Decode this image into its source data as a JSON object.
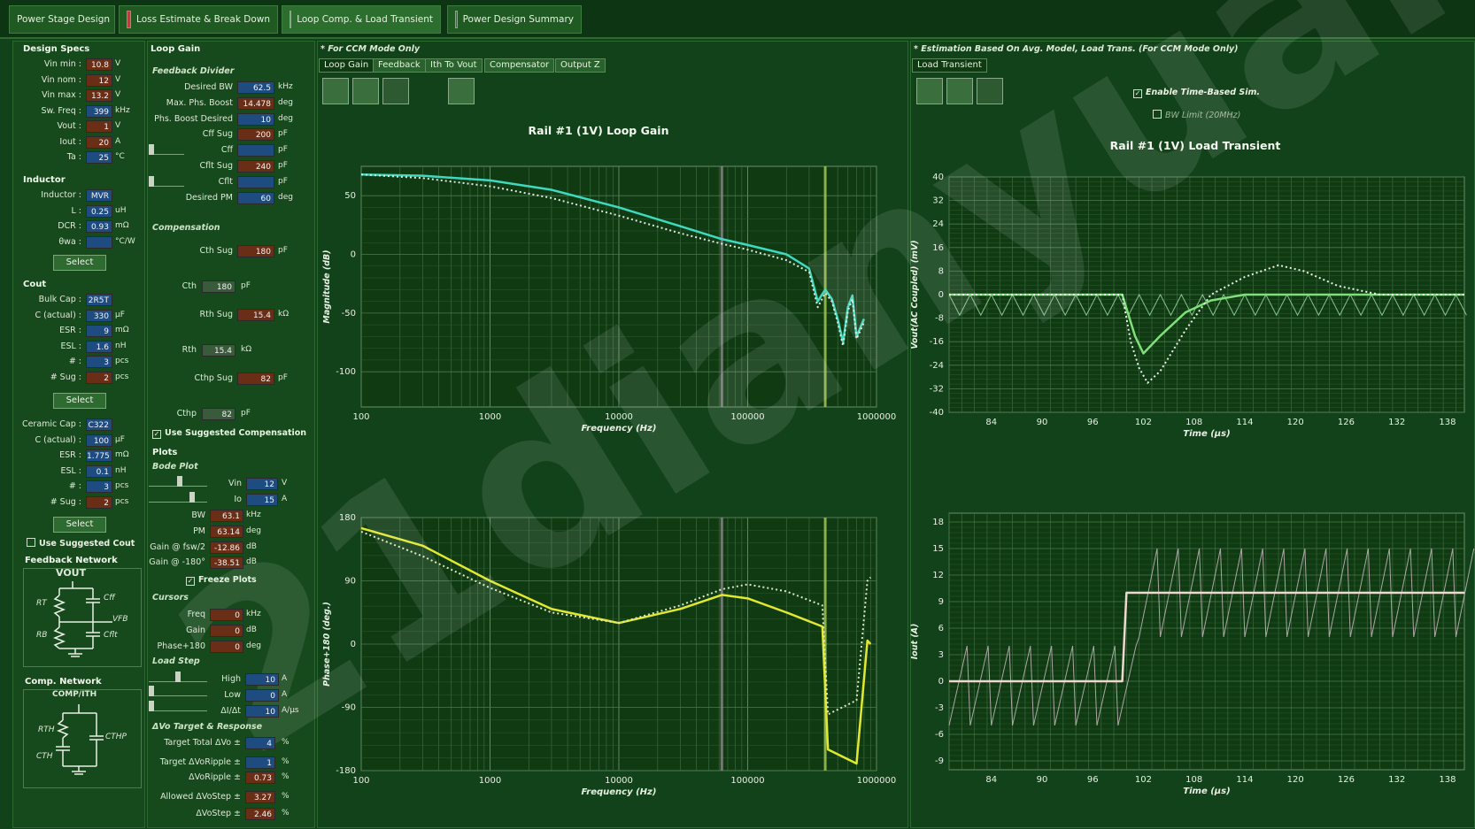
{
  "tabs": [
    {
      "label": "Power Stage Design"
    },
    {
      "label": "Loss Estimate & Break Down"
    },
    {
      "label": "Loop Comp. & Load Transient"
    },
    {
      "label": "Power Design Summary"
    }
  ],
  "design_specs": {
    "title": "Design Specs",
    "rows": [
      {
        "label": "Vin min :",
        "value": "10.8",
        "unit": "V",
        "color": "o"
      },
      {
        "label": "Vin nom :",
        "value": "12",
        "unit": "V",
        "color": "o"
      },
      {
        "label": "Vin max :",
        "value": "13.2",
        "unit": "V",
        "color": "o"
      },
      {
        "label": "Sw. Freq :",
        "value": "399",
        "unit": "kHz",
        "color": "b"
      },
      {
        "label": "Vout :",
        "value": "1",
        "unit": "V",
        "color": "o"
      },
      {
        "label": "Iout :",
        "value": "20",
        "unit": "A",
        "color": "o"
      },
      {
        "label": "Ta :",
        "value": "25",
        "unit": "°C",
        "color": "b"
      }
    ]
  },
  "inductor": {
    "title": "Inductor",
    "rows": [
      {
        "label": "Inductor :",
        "value": "MVR",
        "unit": "",
        "color": "b"
      },
      {
        "label": "L :",
        "value": "0.25",
        "unit": "uH",
        "color": "b"
      },
      {
        "label": "DCR :",
        "value": "0.93",
        "unit": "mΩ",
        "color": "b"
      },
      {
        "label": "θwa :",
        "value": "",
        "unit": "°C/W",
        "color": "b"
      }
    ],
    "select": "Select"
  },
  "cout": {
    "title": "Cout",
    "bulk": [
      {
        "label": "Bulk Cap :",
        "value": "2R5T",
        "unit": "",
        "color": "b"
      },
      {
        "label": "C (actual) :",
        "value": "330",
        "unit": "µF",
        "color": "b"
      },
      {
        "label": "ESR :",
        "value": "9",
        "unit": "mΩ",
        "color": "b"
      },
      {
        "label": "ESL :",
        "value": "1.6",
        "unit": "nH",
        "color": "b"
      },
      {
        "label": "# :",
        "value": "3",
        "unit": "pcs",
        "color": "b"
      },
      {
        "label": "# Sug :",
        "value": "2",
        "unit": "pcs",
        "color": "o"
      }
    ],
    "select1": "Select",
    "ceramic": [
      {
        "label": "Ceramic Cap :",
        "value": "C322",
        "unit": "",
        "color": "b"
      },
      {
        "label": "C (actual) :",
        "value": "100",
        "unit": "µF",
        "color": "b"
      },
      {
        "label": "ESR :",
        "value": "1.775",
        "unit": "mΩ",
        "color": "b"
      },
      {
        "label": "ESL :",
        "value": "0.1",
        "unit": "nH",
        "color": "b"
      },
      {
        "label": "# :",
        "value": "3",
        "unit": "pcs",
        "color": "b"
      },
      {
        "label": "# Sug :",
        "value": "2",
        "unit": "pcs",
        "color": "o"
      }
    ],
    "select2": "Select",
    "use_suggested": "Use Suggested Cout"
  },
  "feedback_network": {
    "title": "Feedback Network",
    "vout": "VOUT",
    "rt": "RT",
    "rb": "RB",
    "cff": "Cff",
    "cflt": "Cflt",
    "vfb": "VFB"
  },
  "comp_network": {
    "title": "Comp. Network",
    "node": "COMP/ITH",
    "rth": "RTH",
    "cth": "CTH",
    "cthp": "CTHP"
  },
  "loop_gain": {
    "title": "Loop Gain",
    "fb_title": "Feedback Divider",
    "fb_rows": [
      {
        "label": "Desired BW",
        "value": "62.5",
        "unit": "kHz",
        "color": "b"
      },
      {
        "label": "Max. Phs. Boost",
        "value": "14.478",
        "unit": "deg",
        "color": "o"
      },
      {
        "label": "Phs. Boost Desired",
        "value": "10",
        "unit": "deg",
        "color": "b"
      },
      {
        "label": "Cff Sug",
        "value": "200",
        "unit": "pF",
        "color": "o"
      },
      {
        "label": "Cff",
        "value": "",
        "unit": "pF",
        "color": "b"
      },
      {
        "label": "Cflt Sug",
        "value": "240",
        "unit": "pF",
        "color": "o"
      },
      {
        "label": "Cflt",
        "value": "",
        "unit": "pF",
        "color": "b"
      },
      {
        "label": "Desired PM",
        "value": "60",
        "unit": "deg",
        "color": "b"
      }
    ],
    "comp_title": "Compensation",
    "comp_rows": [
      {
        "label": "Cth Sug",
        "value": "180",
        "unit": "pF",
        "color": "o"
      },
      {
        "label": "Cth",
        "value": "180",
        "unit": "pF",
        "color": "g"
      },
      {
        "label": "Rth Sug",
        "value": "15.4",
        "unit": "kΩ",
        "color": "o"
      },
      {
        "label": "Rth",
        "value": "15.4",
        "unit": "kΩ",
        "color": "g"
      },
      {
        "label": "Cthp Sug",
        "value": "82",
        "unit": "pF",
        "color": "o"
      },
      {
        "label": "Cthp",
        "value": "82",
        "unit": "pF",
        "color": "g"
      }
    ],
    "use_suggested": "Use Suggested Compensation",
    "plots_title": "Plots",
    "bode_title": "Bode Plot",
    "bode_rows": [
      {
        "label": "Vin",
        "value": "12",
        "unit": "V",
        "color": "b"
      },
      {
        "label": "Io",
        "value": "15",
        "unit": "A",
        "color": "b"
      },
      {
        "label": "BW",
        "value": "63.1",
        "unit": "kHz",
        "color": "o"
      },
      {
        "label": "PM",
        "value": "63.14",
        "unit": "deg",
        "color": "o"
      },
      {
        "label": "Gain @ fsw/2",
        "value": "-12.86",
        "unit": "dB",
        "color": "o"
      },
      {
        "label": "Gain @ -180°",
        "value": "-38.51",
        "unit": "dB",
        "color": "o"
      }
    ],
    "freeze": "Freeze Plots",
    "cursors_title": "Cursors",
    "cursor_rows": [
      {
        "label": "Freq",
        "value": "0",
        "unit": "kHz",
        "color": "o"
      },
      {
        "label": "Gain",
        "value": "0",
        "unit": "dB",
        "color": "o"
      },
      {
        "label": "Phase+180",
        "value": "0",
        "unit": "deg",
        "color": "o"
      }
    ],
    "step_title": "Load Step",
    "step_rows": [
      {
        "label": "High",
        "value": "10",
        "unit": "A",
        "color": "b"
      },
      {
        "label": "Low",
        "value": "0",
        "unit": "A",
        "color": "b"
      },
      {
        "label": "ΔI/Δt",
        "value": "10",
        "unit": "A/µs",
        "color": "b"
      }
    ],
    "target_title": "ΔVo Target & Response",
    "target_rows": [
      {
        "label": "Target Total ΔVo ±",
        "value": "4",
        "unit": "%",
        "color": "b"
      },
      {
        "label": "Target ΔVoRipple ±",
        "value": "1",
        "unit": "%",
        "color": "b"
      },
      {
        "label": "ΔVoRipple ±",
        "value": "0.73",
        "unit": "%",
        "color": "o"
      },
      {
        "label": "Allowed ΔVoStep ±",
        "value": "3.27",
        "unit": "%",
        "color": "o"
      },
      {
        "label": "ΔVoStep ±",
        "value": "2.46",
        "unit": "%",
        "color": "o"
      }
    ]
  },
  "center": {
    "note": "* For CCM Mode Only",
    "tabs": [
      "Loop Gain",
      "Feedback",
      "Ith To Vout",
      "Compensator",
      "Output Z"
    ],
    "title": "Rail #1 (1V) Loop Gain",
    "mag_ylabel": "Magnitude (dB)",
    "phase_ylabel": "Phase+180 (deg.)",
    "xlabel": "Frequency (Hz)"
  },
  "right": {
    "note": "* Estimation Based On Avg. Model, Load Trans. (For CCM Mode Only)",
    "tab": "Load Transient",
    "enable": "Enable Time-Based Sim.",
    "bw_limit": "BW Limit (20MHz)",
    "title": "Rail #1 (1V) Load Transient",
    "v_ylabel": "Vout(AC Coupled) (mV)",
    "i_ylabel": "Iout (A)",
    "xlabel": "Time (µs)"
  },
  "watermark": "21dianyuan",
  "chart_data": [
    {
      "type": "line",
      "title": "Rail #1 (1V) Loop Gain",
      "xlabel": "Frequency (Hz)",
      "ylabel": "Magnitude (dB)",
      "xscale": "log",
      "xticks": [
        "100",
        "1000",
        "10000",
        "100000",
        "1000000"
      ],
      "yticks": [
        "50",
        "0",
        "-50",
        "-100"
      ],
      "xlim": [
        100,
        1000000
      ],
      "ylim": [
        -130,
        75
      ],
      "series": [
        {
          "x": [
            100,
            300,
            1000,
            3000,
            10000,
            30000,
            63100,
            100000,
            200000,
            300000,
            350000,
            400000,
            450000,
            500000,
            550000,
            600000,
            650000,
            700000,
            800000
          ],
          "values": [
            68,
            67,
            63,
            55,
            40,
            24,
            13,
            8,
            0,
            -12,
            -40,
            -30,
            -38,
            -55,
            -75,
            -45,
            -35,
            -70,
            -55
          ],
          "color": "#3fd9c0",
          "style": "solid"
        },
        {
          "x": [
            100,
            300,
            1000,
            3000,
            10000,
            30000,
            63100,
            100000,
            200000,
            300000,
            350000,
            400000,
            450000,
            500000,
            550000,
            600000,
            650000,
            700000,
            800000
          ],
          "values": [
            68,
            65,
            58,
            48,
            33,
            18,
            9,
            4,
            -5,
            -15,
            -45,
            -33,
            -40,
            -58,
            -78,
            -48,
            -38,
            -72,
            -58
          ],
          "color": "#dfe8e0",
          "style": "dotted"
        }
      ],
      "markers": [
        {
          "x": 63000,
          "color": "#8a8a8a"
        },
        {
          "x": 400000,
          "color": "#a8c850"
        }
      ]
    },
    {
      "type": "line",
      "title": "",
      "xlabel": "Frequency (Hz)",
      "ylabel": "Phase+180 (deg.)",
      "xscale": "log",
      "xticks": [
        "100",
        "1000",
        "10000",
        "100000",
        "1000000"
      ],
      "yticks": [
        "180",
        "90",
        "0",
        "-90",
        "-180"
      ],
      "xlim": [
        100,
        1000000
      ],
      "ylim": [
        -180,
        180
      ],
      "series": [
        {
          "x": [
            100,
            300,
            1000,
            3000,
            10000,
            30000,
            63100,
            100000,
            200000,
            380000,
            420000,
            700000,
            850000,
            900000
          ],
          "values": [
            165,
            140,
            90,
            50,
            30,
            50,
            70,
            65,
            45,
            25,
            -150,
            -170,
            5,
            0
          ],
          "color": "#e0e830",
          "style": "solid"
        },
        {
          "x": [
            100,
            300,
            1000,
            3000,
            10000,
            30000,
            63100,
            100000,
            200000,
            380000,
            420000,
            700000,
            850000,
            900000
          ],
          "values": [
            160,
            125,
            80,
            45,
            30,
            55,
            78,
            85,
            75,
            55,
            -100,
            -80,
            90,
            95
          ],
          "color": "#dfe8c0",
          "style": "dotted"
        }
      ]
    },
    {
      "type": "line",
      "title": "Rail #1 (1V) Load Transient",
      "xlabel": "Time (µs)",
      "ylabel": "Vout(AC Coupled) (mV)",
      "xticks": [
        "84",
        "90",
        "96",
        "102",
        "108",
        "114",
        "120",
        "126",
        "132",
        "138"
      ],
      "yticks": [
        "40",
        "32",
        "24",
        "16",
        "8",
        "0",
        "-8",
        "-16",
        "-24",
        "-32",
        "-40"
      ],
      "xlim": [
        79,
        140
      ],
      "ylim": [
        -40,
        40
      ],
      "series": [
        {
          "x": [
            79,
            99.5,
            101,
            102,
            104,
            107,
            110,
            114,
            118,
            122,
            126,
            130,
            140
          ],
          "values": [
            0,
            0,
            -14,
            -20,
            -14,
            -6,
            -2,
            0,
            0,
            0,
            0,
            0,
            0
          ],
          "color": "#7fe07a",
          "style": "solid"
        },
        {
          "x": [
            79,
            99.5,
            100.5,
            101.5,
            102.5,
            104,
            107,
            110,
            114,
            118,
            121,
            125,
            130,
            140
          ],
          "values": [
            0,
            0,
            -16,
            -25,
            -30,
            -26,
            -12,
            0,
            6,
            10,
            8,
            3,
            0,
            0
          ],
          "color": "#e8f0e8",
          "style": "dotted"
        }
      ],
      "ripple": {
        "amplitude_mv": -7,
        "period_us": 2.5,
        "x_start": 79,
        "x_end": 140
      }
    },
    {
      "type": "line",
      "title": "",
      "xlabel": "Time (µs)",
      "ylabel": "Iout (A)",
      "xticks": [
        "84",
        "90",
        "96",
        "102",
        "108",
        "114",
        "120",
        "126",
        "132",
        "138"
      ],
      "yticks": [
        "18",
        "15",
        "12",
        "9",
        "6",
        "3",
        "0",
        "-3",
        "-6",
        "-9"
      ],
      "xlim": [
        79,
        140
      ],
      "ylim": [
        -10,
        19
      ],
      "series": [
        {
          "x": [
            79,
            99.5,
            100,
            140
          ],
          "values": [
            0,
            0,
            10,
            10
          ],
          "color": "#f0d8d0",
          "style": "solid"
        }
      ],
      "ripple": {
        "low": -5,
        "high": 4,
        "step_low": 5,
        "step_high": 15,
        "period_us": 2.5,
        "step_at": 99.5
      }
    }
  ]
}
